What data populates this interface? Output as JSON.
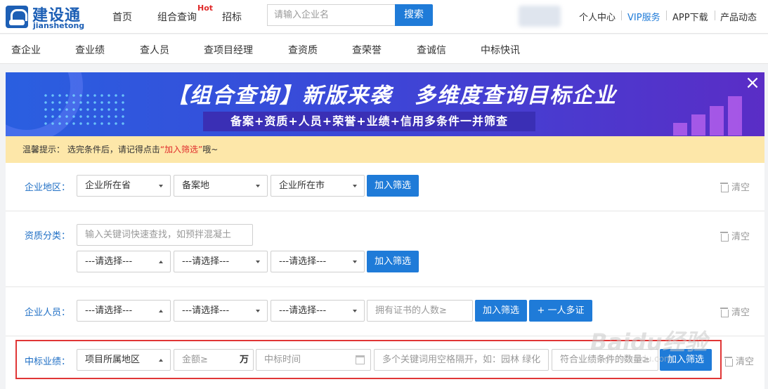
{
  "header": {
    "logo_cn": "建设通",
    "logo_en": "jianshetong",
    "nav": [
      "首页",
      "组合查询",
      "招标"
    ],
    "hot_badge": "Hot",
    "search_placeholder": "请输入企业名",
    "search_button": "搜索",
    "links": [
      "个人中心",
      "VIP服务",
      "APP下载",
      "产品动态"
    ]
  },
  "subnav": [
    "查企业",
    "查业绩",
    "查人员",
    "查项目经理",
    "查资质",
    "查荣誉",
    "查诚信",
    "中标快讯"
  ],
  "banner": {
    "title": "【组合查询】新版来袭　多维度查询目标企业",
    "subtitle": "备案+资质+人员+荣誉+业绩+信用多条件一并筛查"
  },
  "notice": {
    "prefix": "温馨提示：  选完条件后，请记得点击",
    "highlight": "“加入筛选”",
    "suffix": "哦~"
  },
  "filters": {
    "clear_label": "清空",
    "add_label": "加入筛选",
    "region": {
      "label": "企业地区：",
      "selects": [
        "企业所在省",
        "备案地",
        "企业所在市"
      ]
    },
    "qualification": {
      "label": "资质分类：",
      "search_placeholder": "输入关键词快速查找，如预拌混凝土",
      "selects": [
        "---请选择---",
        "---请选择---",
        "---请选择---"
      ]
    },
    "personnel": {
      "label": "企业人员：",
      "selects": [
        "---请选择---",
        "---请选择---",
        "---请选择---"
      ],
      "count_placeholder": "拥有证书的人数≥",
      "multi_cert_button": "+  一人多证"
    },
    "winning": {
      "label": "中标业绩：",
      "region_select": "项目所属地区",
      "amount_placeholder": "金额≥",
      "amount_unit": "万",
      "time_placeholder": "中标时间",
      "keywords_placeholder": "多个关键词用空格隔开，如：园林 绿化",
      "count_placeholder": "符合业绩条件的数量≥"
    }
  },
  "watermark": {
    "text": "Baidu经验",
    "sub": "jingyan.baidu.com"
  }
}
